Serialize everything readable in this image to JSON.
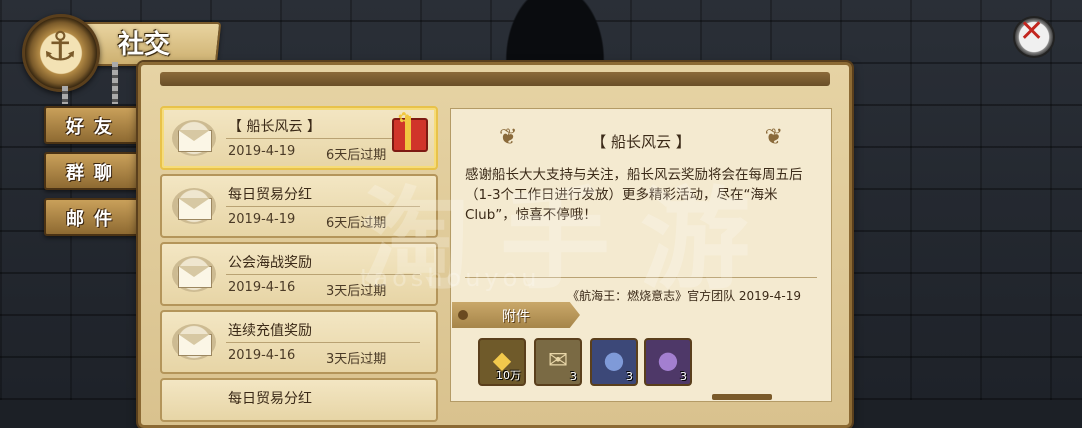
{
  "header": {
    "title": "社交"
  },
  "side_tabs": [
    {
      "label": "好友"
    },
    {
      "label": "群聊"
    },
    {
      "label": "邮件"
    }
  ],
  "mails": [
    {
      "title": "【 船长风云 】",
      "date": "2019-4-19",
      "expire": "6天后过期",
      "selected": true,
      "has_gift": true
    },
    {
      "title": "每日贸易分红",
      "date": "2019-4-19",
      "expire": "6天后过期"
    },
    {
      "title": "公会海战奖励",
      "date": "2019-4-16",
      "expire": "3天后过期"
    },
    {
      "title": "连续充值奖励",
      "date": "2019-4-16",
      "expire": "3天后过期"
    },
    {
      "title": "每日贸易分红",
      "date": "",
      "expire": ""
    }
  ],
  "detail": {
    "title": "【 船长风云 】",
    "body": "感谢船长大大支持与关注，船长风云奖励将会在每周五后（1-3个工作日进行发放）更多精彩活动，尽在“海米Club”，惊喜不停哦！",
    "signature": "《航海王：燃烧意志》官方团队 2019-4-19",
    "attachment_label": "附件",
    "items": [
      {
        "icon": "gold-icon",
        "glyph": "◆",
        "count": "10万",
        "bg": "#6f5a2a",
        "color": "#f2c94c"
      },
      {
        "icon": "map-scroll-icon",
        "glyph": "✉",
        "count": "3",
        "bg": "#7a6a44",
        "color": "#e8d6a8"
      },
      {
        "icon": "blue-bag-icon",
        "glyph": "●",
        "count": "3",
        "bg": "#3c4878",
        "color": "#7f9ad8"
      },
      {
        "icon": "purple-bag-icon",
        "glyph": "●",
        "count": "3",
        "bg": "#4e3868",
        "color": "#a37fd0"
      }
    ]
  },
  "watermark": {
    "main": "淘手游",
    "sub": "taoshouyou"
  },
  "colors": {
    "accent": "#e8c24a",
    "close": "#c2261f",
    "panel": "#e6d3a4"
  }
}
